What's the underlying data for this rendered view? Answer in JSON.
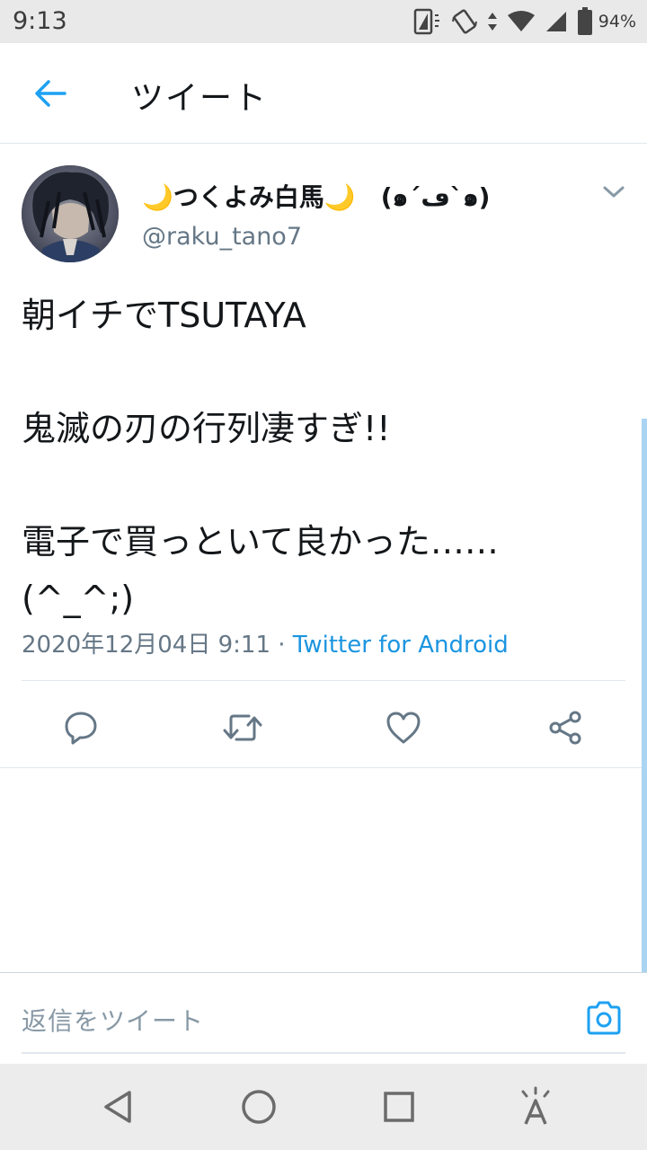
{
  "status_bar": {
    "time": "9:13",
    "battery_percent": "94%"
  },
  "header": {
    "title": "ツイート"
  },
  "tweet": {
    "display_name": "🌙つくよみ白馬🌙　(๑´ڡ`๑)",
    "handle": "@raku_tano7",
    "body_lines": [
      "朝イチでTSUTAYA",
      "",
      "鬼滅の刃の行列凄すぎ!!",
      "",
      "電子で買っといて良かった……",
      "(^_^;)"
    ],
    "timestamp": "2020年12月04日 9:11",
    "separator": " · ",
    "source": "Twitter for Android"
  },
  "reply": {
    "placeholder": "返信をツイート"
  },
  "colors": {
    "accent": "#1da1f2",
    "muted": "#657786",
    "divider": "#e1e8ed"
  },
  "icons": {
    "actions": [
      "reply-icon",
      "retweet-icon",
      "like-icon",
      "share-icon"
    ],
    "nav": [
      "back-triangle-icon",
      "home-circle-icon",
      "recents-square-icon",
      "accessibility-icon"
    ]
  }
}
